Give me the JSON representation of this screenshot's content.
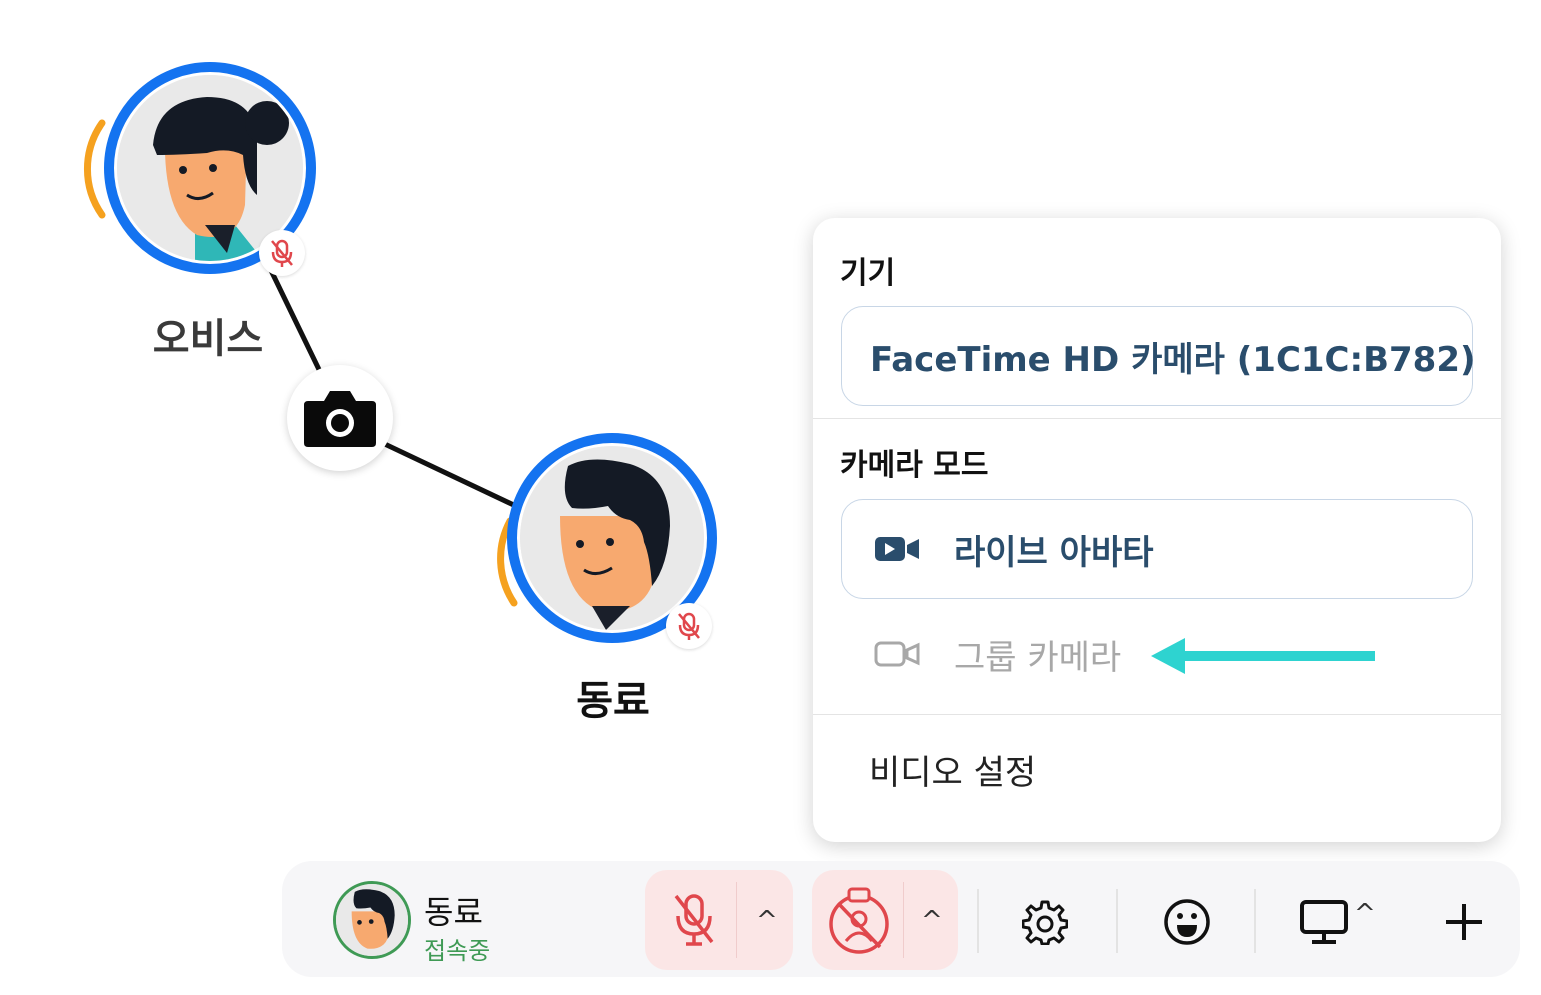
{
  "participants": [
    {
      "name": "오비스",
      "muted": true
    },
    {
      "name": "동료",
      "muted": true
    }
  ],
  "camera_menu": {
    "device_section_title": "기기",
    "selected_device": "FaceTime HD 카메라 (1C1C:B782)",
    "mode_section_title": "카메라 모드",
    "modes": [
      {
        "label": "라이브 아바타",
        "selected": true,
        "icon": "video-filled-icon"
      },
      {
        "label": "그룹 카메라",
        "selected": false,
        "icon": "video-outline-icon"
      }
    ],
    "video_settings_label": "비디오 설정"
  },
  "toolbar": {
    "self_name": "동료",
    "self_status": "접속중",
    "mic_caret": "^",
    "camera_caret": "^",
    "screen_caret": "^",
    "icons": [
      "mic-off-icon",
      "camera-avatar-off-icon",
      "gear-icon",
      "emoji-icon",
      "monitor-icon",
      "plus-icon"
    ]
  },
  "colors": {
    "ring_blue": "#1473f0",
    "speaking_orange": "#f5a11f",
    "muted_red": "#e0474c",
    "status_green": "#3f9a55",
    "menu_text_blue": "#2a4d6c",
    "arrow_teal": "#2ed3d0"
  }
}
